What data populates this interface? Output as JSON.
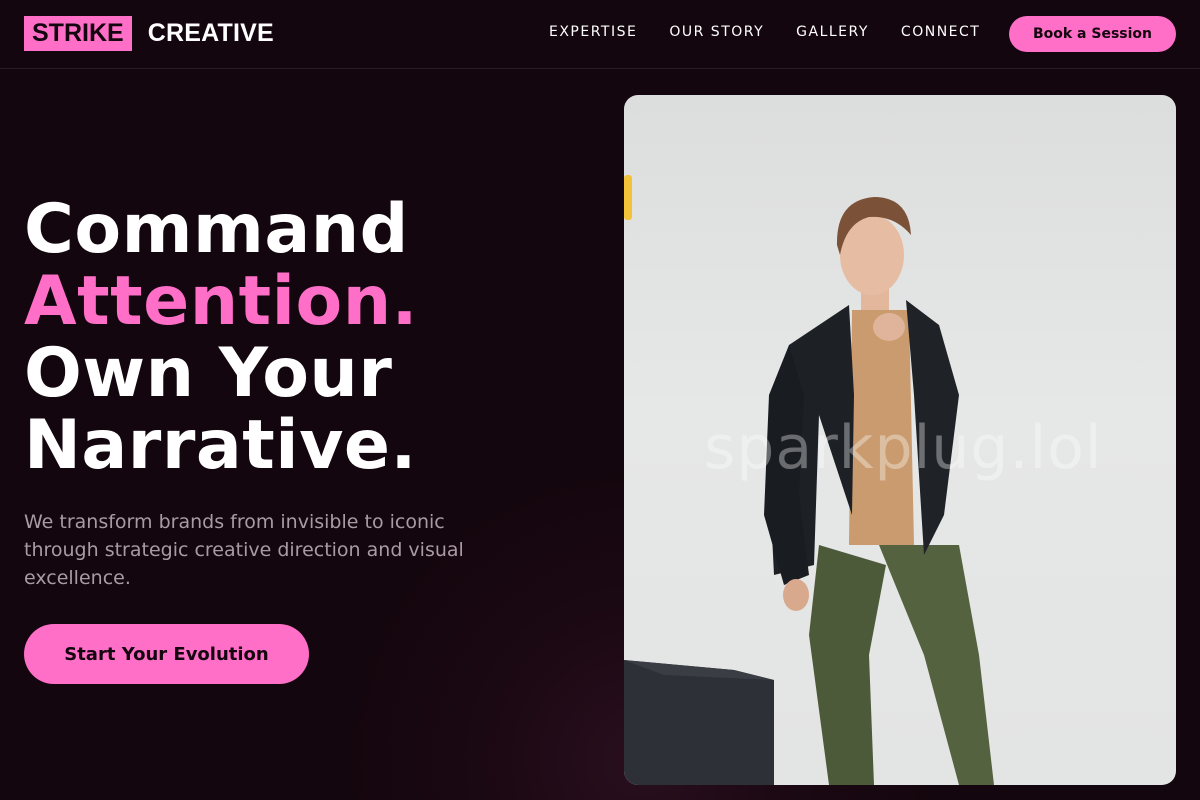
{
  "brand": {
    "box_text": "STRIKE",
    "word": "CREATIVE"
  },
  "nav": {
    "items": [
      {
        "label": "EXPERTISE"
      },
      {
        "label": "OUR STORY"
      },
      {
        "label": "GALLERY"
      },
      {
        "label": "CONNECT"
      }
    ],
    "cta_label": "Book a Session"
  },
  "hero": {
    "headline_line1": "Command",
    "headline_line2": "Attention.",
    "headline_line3": "Own Your",
    "headline_line4": "Narrative.",
    "subtext": "We transform brands from invisible to iconic through strategic creative direction and visual excellence.",
    "cta_label": "Start Your Evolution"
  },
  "photo": {
    "watermark": "sparkplug.lol"
  },
  "colors": {
    "accent": "#ff6ec7",
    "background": "#14060e",
    "muted_text": "#a99aa3"
  }
}
